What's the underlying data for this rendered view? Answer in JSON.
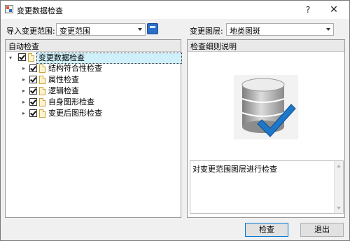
{
  "window": {
    "title": "变更数据检查",
    "help_label": "?",
    "close_label": "✕"
  },
  "top": {
    "import_label": "导入变更范围:",
    "import_value": "变更范围",
    "layer_label": "变更图层:",
    "layer_value": "地类图斑"
  },
  "left_panel": {
    "title": "自动检查",
    "root": {
      "label": "变更数据检查",
      "checked": true,
      "expanded": true
    },
    "items": [
      {
        "label": "结构符合性检查",
        "checked": true
      },
      {
        "label": "属性检查",
        "checked": true
      },
      {
        "label": "逻辑检查",
        "checked": true
      },
      {
        "label": "自身图形检查",
        "checked": true
      },
      {
        "label": "变更后图形检查",
        "checked": true
      }
    ]
  },
  "right_panel": {
    "title": "检查细则说明",
    "icon": "database-check-icon",
    "description": "对变更范围图层进行检查"
  },
  "buttons": {
    "check": "检查",
    "exit": "退出"
  },
  "colors": {
    "check_mark": "#1f77c9",
    "selection": "#cfeffb"
  }
}
